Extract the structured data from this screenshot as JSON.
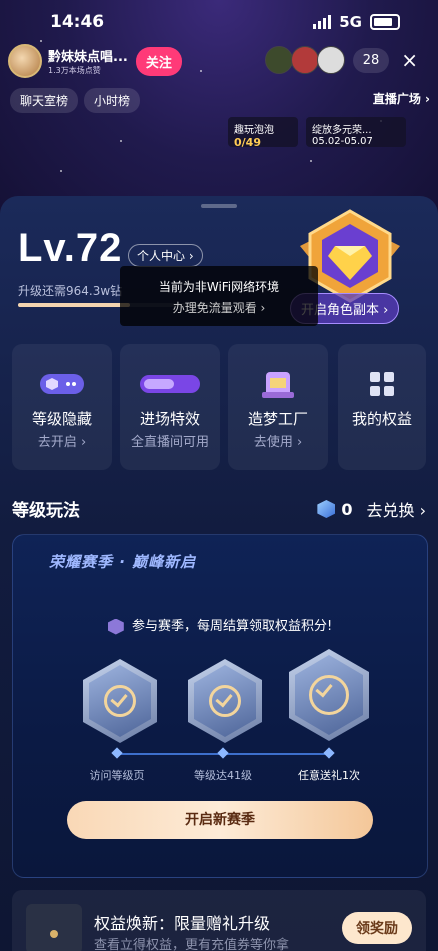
{
  "status": {
    "time": "14:46",
    "network": "5G"
  },
  "host": {
    "name": "黔妹妹点唱...",
    "likes": "1.3万本场点赞",
    "follow_label": "关注"
  },
  "viewers": {
    "count": "28",
    "close_icon": "×"
  },
  "chips": {
    "chat": "聊天室榜",
    "hourly": "小时榜",
    "plaza": "直播广场 ›"
  },
  "events": [
    {
      "title": "趣玩泡泡",
      "progress": "0/49"
    },
    {
      "title": "绽放多元荣...",
      "dates": "05.02-05.07"
    }
  ],
  "level": {
    "label": "Lv.72",
    "center_label": "个人中心 ›",
    "upgrade_text": "升级还需964.3w钻",
    "progress": 0.52,
    "role_button": "开启角色副本 ›"
  },
  "cards": [
    {
      "title": "等级隐藏",
      "sub": "去开启 ›",
      "icon": "eye-badge-icon"
    },
    {
      "title": "进场特效",
      "sub": "全直播间可用",
      "icon": "entry-effect-icon"
    },
    {
      "title": "造梦工厂",
      "sub": "去使用 ›",
      "icon": "dream-factory-icon"
    },
    {
      "title": "我的权益",
      "sub": "",
      "icon": "grid-icon"
    }
  ],
  "toast": {
    "line1": "当前为非WiFi网络环境",
    "line2": "办理免流量观看 ›"
  },
  "section": {
    "title": "等级玩法",
    "points": "0",
    "exchange": "去兑换 ›"
  },
  "season": {
    "title": "荣耀赛季 · 巅峰新启",
    "info": "参与赛季，每周结算领取权益积分!",
    "steps": [
      "访问等级页",
      "等级达41级",
      "任意送礼1次"
    ],
    "button": "开启新赛季"
  },
  "promo": {
    "title": "权益焕新：限量赠礼升级",
    "sub": "查看立得权益，更有充值券等你拿",
    "button": "领奖励"
  },
  "colors": {
    "accent": "#ff3a78",
    "gold": "#f3d59c",
    "sheet": "#121c3f"
  }
}
